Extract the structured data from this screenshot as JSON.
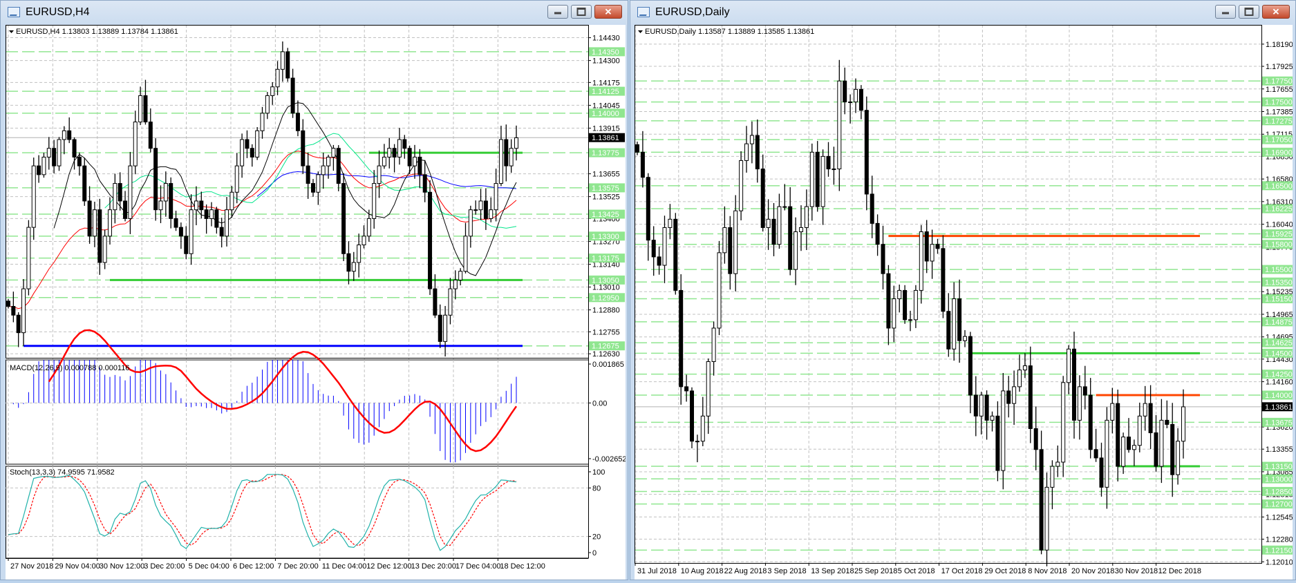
{
  "left": {
    "title": "EURUSD,H4",
    "header": "EURUSD,H4  1.13803 1.13889 1.13784 1.13861",
    "current_price": "1.13861",
    "price_labels": [
      "1.14430",
      "1.14300",
      "1.14175",
      "1.14045",
      "1.13915",
      "1.13655",
      "1.13525",
      "1.13400",
      "1.13270",
      "1.13140",
      "1.13010",
      "1.12880",
      "1.12755",
      "1.12630"
    ],
    "level_labels": [
      "1.14350",
      "1.14125",
      "1.14000",
      "1.13775",
      "1.13575",
      "1.13425",
      "1.13300",
      "1.13175",
      "1.13050",
      "1.12950",
      "1.12675"
    ],
    "trend_lines": [
      {
        "price": 1.13775,
        "from_bar": 71,
        "color": "#33cc33"
      },
      {
        "price": 1.1305,
        "from_bar": 20,
        "color": "#33cc33"
      },
      {
        "price": 1.12675,
        "from_bar": 3,
        "color": "#0000ff"
      }
    ],
    "macd": {
      "label": "MACD(12,26,9) 0.000788 0.000116",
      "axis": [
        "0.001865",
        "0.00",
        "-0.002652"
      ]
    },
    "stoch": {
      "label": "Stoch(13,3,3) 74.9595 71.9582",
      "axis": [
        "100",
        "80",
        "20",
        "0"
      ]
    },
    "time_labels": [
      "27 Nov 2018",
      "29 Nov 04:00",
      "30 Nov 12:00",
      "3 Dec 20:00",
      "5 Dec 04:00",
      "6 Dec 12:00",
      "7 Dec 20:00",
      "11 Dec 04:00",
      "12 Dec 12:00",
      "13 Dec 20:00",
      "17 Dec 04:00",
      "18 Dec 12:00"
    ],
    "closes": [
      1.129,
      1.1285,
      1.1275,
      1.13,
      1.1335,
      1.137,
      1.1365,
      1.1375,
      1.138,
      1.137,
      1.1385,
      1.139,
      1.1385,
      1.1375,
      1.137,
      1.135,
      1.133,
      1.1345,
      1.1315,
      1.133,
      1.1345,
      1.136,
      1.135,
      1.134,
      1.137,
      1.1395,
      1.141,
      1.1395,
      1.138,
      1.1345,
      1.135,
      1.136,
      1.134,
      1.1335,
      1.133,
      1.132,
      1.1345,
      1.135,
      1.1345,
      1.134,
      1.1345,
      1.1335,
      1.133,
      1.1345,
      1.1355,
      1.137,
      1.1385,
      1.138,
      1.1375,
      1.139,
      1.14,
      1.141,
      1.1415,
      1.1425,
      1.1435,
      1.142,
      1.14,
      1.139,
      1.137,
      1.136,
      1.1355,
      1.1365,
      1.137,
      1.1375,
      1.138,
      1.136,
      1.132,
      1.131,
      1.1315,
      1.1325,
      1.133,
      1.134,
      1.136,
      1.137,
      1.1375,
      1.138,
      1.1375,
      1.1385,
      1.138,
      1.137,
      1.1375,
      1.1365,
      1.1355,
      1.13,
      1.1285,
      1.127,
      1.1285,
      1.13,
      1.1305,
      1.131,
      1.133,
      1.1345,
      1.1345,
      1.135,
      1.134,
      1.1345,
      1.136,
      1.1385,
      1.137,
      1.138,
      1.1386
    ]
  },
  "right": {
    "title": "EURUSD,Daily",
    "header": "EURUSD,Daily  1.13587 1.13889 1.13585 1.13861",
    "current_price": "1.13861",
    "price_labels": [
      "1.18190",
      "1.17925",
      "1.17655",
      "1.17385",
      "1.17115",
      "1.16850",
      "1.16580",
      "1.16310",
      "1.16040",
      "1.15770",
      "1.15235",
      "1.14965",
      "1.14695",
      "1.14430",
      "1.14160",
      "1.13620",
      "1.13355",
      "1.13085",
      "1.12815",
      "1.12545",
      "1.12280",
      "1.12010"
    ],
    "level_labels": [
      "1.17750",
      "1.17500",
      "1.17275",
      "1.17050",
      "1.16900",
      "1.16500",
      "1.16225",
      "1.15925",
      "1.15800",
      "1.15500",
      "1.15350",
      "1.15150",
      "1.14875",
      "1.14625",
      "1.14500",
      "1.14250",
      "1.14000",
      "1.13675",
      "1.13150",
      "1.13000",
      "1.12850",
      "1.12700",
      "1.12150"
    ],
    "trend_lines": [
      {
        "price": 1.159,
        "from_bar": 46,
        "color": "#ff4500"
      },
      {
        "price": 1.145,
        "from_bar": 61,
        "color": "#33cc33"
      },
      {
        "price": 1.14,
        "from_bar": 84,
        "color": "#ff4500"
      },
      {
        "price": 1.1315,
        "from_bar": 88,
        "color": "#33cc33"
      }
    ],
    "time_labels": [
      "31 Jul 2018",
      "10 Aug 2018",
      "22 Aug 2018",
      "3 Sep 2018",
      "13 Sep 2018",
      "25 Sep 2018",
      "5 Oct 2018",
      "17 Oct 2018",
      "29 Oct 2018",
      "8 Nov 2018",
      "20 Nov 2018",
      "30 Nov 2018",
      "12 Dec 2018"
    ],
    "closes": [
      1.169,
      1.166,
      1.1585,
      1.1565,
      1.1555,
      1.16,
      1.161,
      1.1525,
      1.141,
      1.1405,
      1.1345,
      1.1345,
      1.1375,
      1.144,
      1.148,
      1.157,
      1.16,
      1.1545,
      1.162,
      1.168,
      1.17,
      1.171,
      1.167,
      1.16,
      1.161,
      1.158,
      1.1625,
      1.1625,
      1.155,
      1.1595,
      1.16,
      1.1625,
      1.169,
      1.1625,
      1.1685,
      1.167,
      1.167,
      1.1775,
      1.175,
      1.175,
      1.1765,
      1.174,
      1.164,
      1.1605,
      1.158,
      1.1545,
      1.148,
      1.1515,
      1.1525,
      1.149,
      1.149,
      1.1525,
      1.1595,
      1.156,
      1.158,
      1.1575,
      1.15,
      1.1455,
      1.1515,
      1.1465,
      1.147,
      1.14,
      1.1375,
      1.14,
      1.137,
      1.1375,
      1.131,
      1.1405,
      1.139,
      1.141,
      1.143,
      1.1435,
      1.136,
      1.1335,
      1.1215,
      1.129,
      1.1315,
      1.132,
      1.1415,
      1.1455,
      1.137,
      1.141,
      1.14,
      1.1335,
      1.1325,
      1.129,
      1.137,
      1.139,
      1.1315,
      1.135,
      1.1335,
      1.134,
      1.1375,
      1.139,
      1.1355,
      1.1315,
      1.137,
      1.1365,
      1.1305,
      1.1345,
      1.1386
    ]
  },
  "colors": {
    "level": "#90e690",
    "bull": "#ffffff",
    "bear": "#000000",
    "macd_hist": "#0000ff",
    "macd_signal": "#ff0000",
    "stoch_main": "#20b2aa",
    "stoch_signal": "#ff0000"
  }
}
